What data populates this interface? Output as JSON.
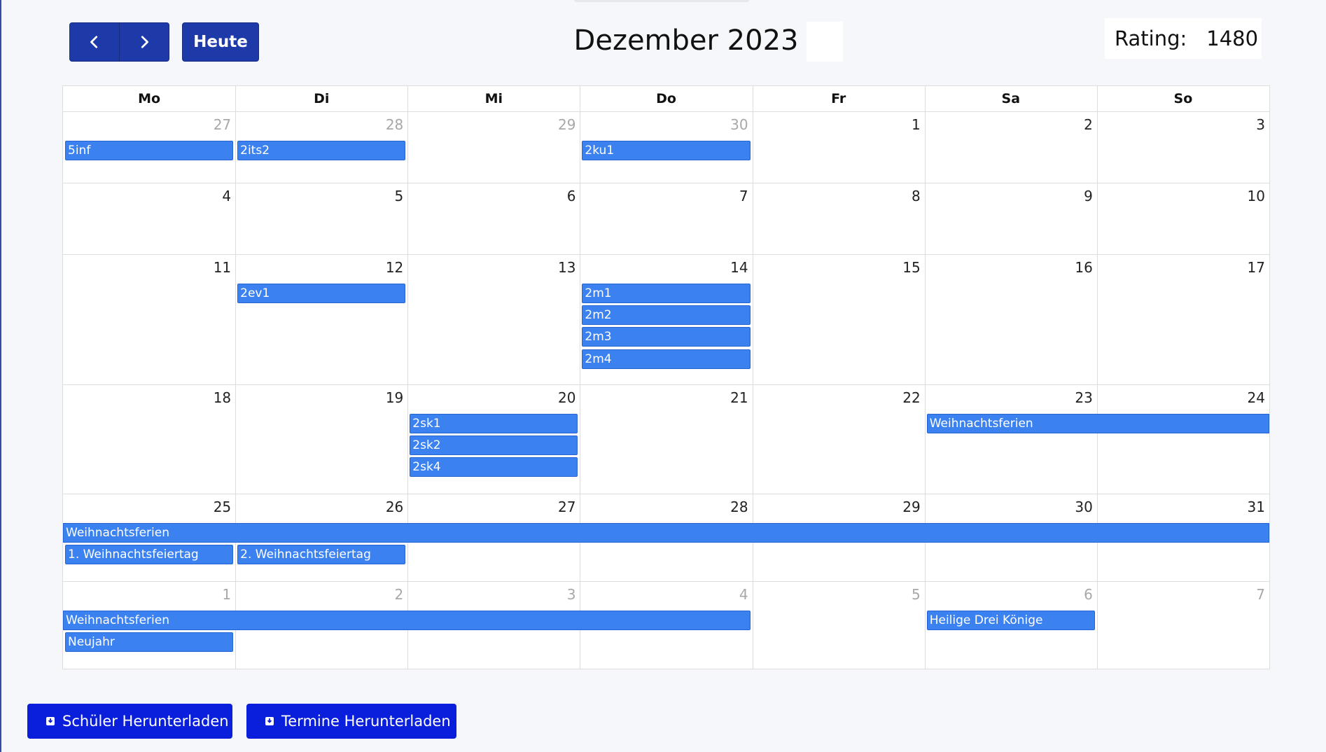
{
  "toolbar": {
    "prev_icon": "chevron-left-icon",
    "next_icon": "chevron-right-icon",
    "today_label": "Heute",
    "title": "Dezember 2023",
    "rating_label": "Rating:",
    "rating_value": "1480"
  },
  "colors": {
    "primary": "#1e3aa8",
    "event": "#3b82f0",
    "download": "#0a1fdc"
  },
  "weekdays": [
    "Mo",
    "Di",
    "Mi",
    "Do",
    "Fr",
    "Sa",
    "So"
  ],
  "weeks": [
    {
      "days": [
        {
          "num": "27",
          "other": true
        },
        {
          "num": "28",
          "other": true
        },
        {
          "num": "29",
          "other": true
        },
        {
          "num": "30",
          "other": true
        },
        {
          "num": "1"
        },
        {
          "num": "2"
        },
        {
          "num": "3"
        }
      ],
      "events": [
        {
          "title": "5inf",
          "start": 0,
          "span": 1,
          "row": 0
        },
        {
          "title": "2its2",
          "start": 1,
          "span": 1,
          "row": 0
        },
        {
          "title": "2ku1",
          "start": 3,
          "span": 1,
          "row": 0
        }
      ]
    },
    {
      "days": [
        {
          "num": "4"
        },
        {
          "num": "5"
        },
        {
          "num": "6"
        },
        {
          "num": "7"
        },
        {
          "num": "8"
        },
        {
          "num": "9"
        },
        {
          "num": "10"
        }
      ],
      "events": []
    },
    {
      "days": [
        {
          "num": "11"
        },
        {
          "num": "12"
        },
        {
          "num": "13"
        },
        {
          "num": "14"
        },
        {
          "num": "15"
        },
        {
          "num": "16"
        },
        {
          "num": "17"
        }
      ],
      "events": [
        {
          "title": "2ev1",
          "start": 1,
          "span": 1,
          "row": 0
        },
        {
          "title": "2m1",
          "start": 3,
          "span": 1,
          "row": 0
        },
        {
          "title": "2m2",
          "start": 3,
          "span": 1,
          "row": 1
        },
        {
          "title": "2m3",
          "start": 3,
          "span": 1,
          "row": 2
        },
        {
          "title": "2m4",
          "start": 3,
          "span": 1,
          "row": 3
        }
      ]
    },
    {
      "days": [
        {
          "num": "18"
        },
        {
          "num": "19"
        },
        {
          "num": "20"
        },
        {
          "num": "21"
        },
        {
          "num": "22"
        },
        {
          "num": "23"
        },
        {
          "num": "24"
        }
      ],
      "events": [
        {
          "title": "2sk1",
          "start": 2,
          "span": 1,
          "row": 0
        },
        {
          "title": "2sk2",
          "start": 2,
          "span": 1,
          "row": 1
        },
        {
          "title": "2sk4",
          "start": 2,
          "span": 1,
          "row": 2
        },
        {
          "title": "Weihnachtsferien",
          "start": 5,
          "span": 2,
          "row": 0,
          "continues_right": true
        }
      ]
    },
    {
      "days": [
        {
          "num": "25"
        },
        {
          "num": "26"
        },
        {
          "num": "27"
        },
        {
          "num": "28"
        },
        {
          "num": "29"
        },
        {
          "num": "30"
        },
        {
          "num": "31"
        }
      ],
      "events": [
        {
          "title": "Weihnachtsferien",
          "start": 0,
          "span": 7,
          "row": 0,
          "continues_left": true,
          "continues_right": true
        },
        {
          "title": "1. Weihnachtsfeiertag",
          "start": 0,
          "span": 1,
          "row": 1
        },
        {
          "title": "2. Weihnachtsfeiertag",
          "start": 1,
          "span": 1,
          "row": 1
        }
      ]
    },
    {
      "days": [
        {
          "num": "1",
          "other": true
        },
        {
          "num": "2",
          "other": true
        },
        {
          "num": "3",
          "other": true
        },
        {
          "num": "4",
          "other": true
        },
        {
          "num": "5",
          "other": true
        },
        {
          "num": "6",
          "other": true
        },
        {
          "num": "7",
          "other": true
        }
      ],
      "events": [
        {
          "title": "Weihnachtsferien",
          "start": 0,
          "span": 4,
          "row": 0,
          "continues_left": true
        },
        {
          "title": "Neujahr",
          "start": 0,
          "span": 1,
          "row": 1
        },
        {
          "title": "Heilige Drei Könige",
          "start": 5,
          "span": 1,
          "row": 0
        }
      ]
    }
  ],
  "downloads": {
    "students_label": "Schüler Herunterladen",
    "appointments_label": "Termine Herunterladen",
    "icon": "download-icon"
  }
}
